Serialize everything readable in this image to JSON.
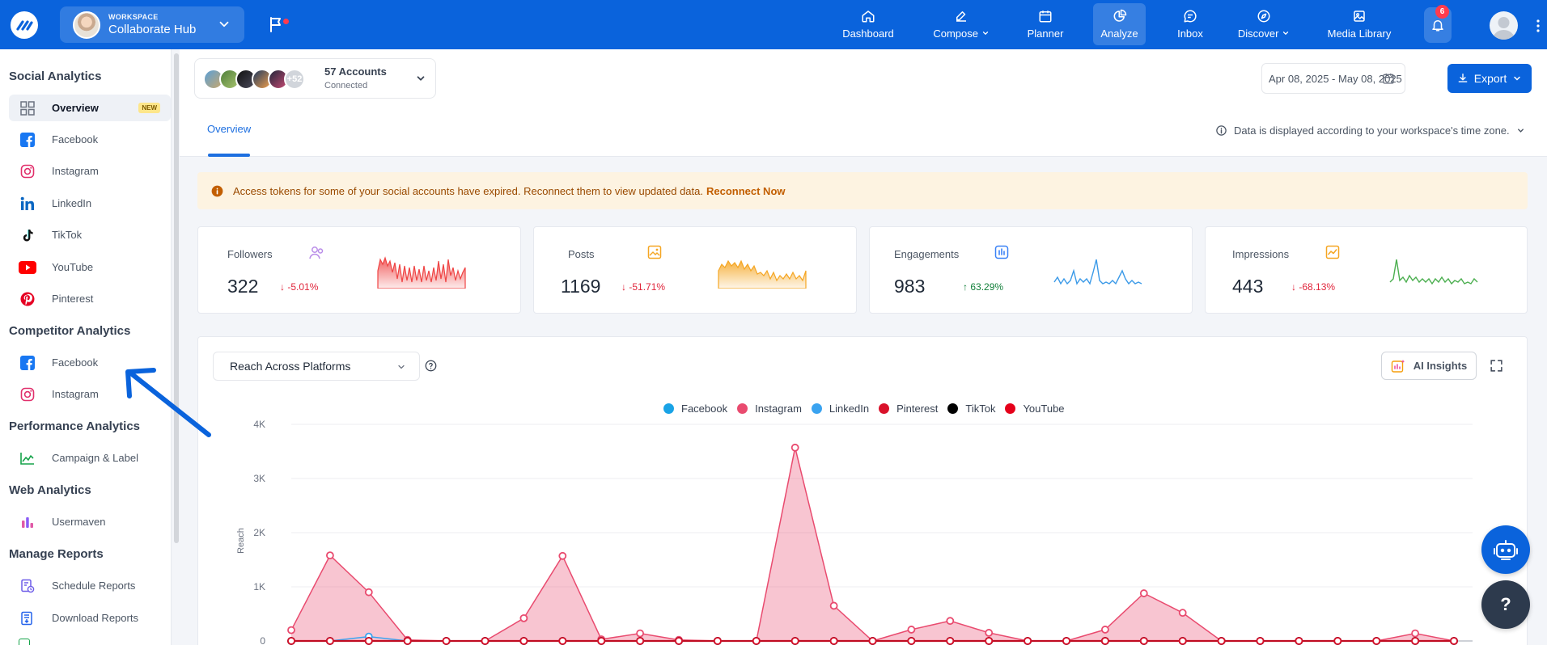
{
  "workspace": {
    "caption": "WORKSPACE",
    "name": "Collaborate Hub"
  },
  "nav": [
    {
      "label": "Dashboard",
      "icon": "home-icon"
    },
    {
      "label": "Compose",
      "icon": "pen-icon"
    },
    {
      "label": "Planner",
      "icon": "calendar-icon"
    },
    {
      "label": "Analyze",
      "icon": "chart-pie-icon"
    },
    {
      "label": "Inbox",
      "icon": "chat-icon"
    },
    {
      "label": "Discover",
      "icon": "compass-icon"
    },
    {
      "label": "Media Library",
      "icon": "image-icon"
    }
  ],
  "notifications": {
    "count": "6"
  },
  "sidebar": {
    "social_heading": "Social Analytics",
    "social_items": [
      {
        "label": "Overview",
        "badge": "NEW"
      },
      {
        "label": "Facebook"
      },
      {
        "label": "Instagram"
      },
      {
        "label": "LinkedIn"
      },
      {
        "label": "TikTok"
      },
      {
        "label": "YouTube"
      },
      {
        "label": "Pinterest"
      }
    ],
    "competitor_heading": "Competitor Analytics",
    "competitor_items": [
      {
        "label": "Facebook"
      },
      {
        "label": "Instagram"
      }
    ],
    "performance_heading": "Performance Analytics",
    "performance_items": [
      {
        "label": "Campaign & Label"
      }
    ],
    "web_heading": "Web Analytics",
    "web_items": [
      {
        "label": "Usermaven"
      }
    ],
    "reports_heading": "Manage Reports",
    "reports_items": [
      {
        "label": "Schedule Reports"
      },
      {
        "label": "Download Reports"
      }
    ]
  },
  "accounts": {
    "count_badge": "+52",
    "title": "57 Accounts",
    "subtitle": "Connected"
  },
  "date_range": "Apr 08, 2025 - May 08, 2025",
  "export_label": "Export",
  "tabs": {
    "overview": "Overview"
  },
  "timezone_note": "Data is displayed according to your workspace's time zone.",
  "alert": {
    "message": "Access tokens for some of your social accounts have expired. Reconnect them to view updated data.",
    "action": "Reconnect Now"
  },
  "kpis": [
    {
      "label": "Followers",
      "value": "322",
      "delta": "-5.01%",
      "direction": "down",
      "color": "#ef4444"
    },
    {
      "label": "Posts",
      "value": "1169",
      "delta": "-51.71%",
      "direction": "down",
      "color": "#f5a623"
    },
    {
      "label": "Engagements",
      "value": "983",
      "delta": "63.29%",
      "direction": "up",
      "color": "#3b9ae8"
    },
    {
      "label": "Impressions",
      "value": "443",
      "delta": "-68.13%",
      "direction": "down",
      "color": "#4caf50"
    }
  ],
  "chart_panel": {
    "selector": "Reach Across Platforms",
    "ai_insights": "AI Insights"
  },
  "chart_data": {
    "type": "area",
    "ylabel": "Reach",
    "ylim": [
      0,
      4000
    ],
    "yticks": [
      "0",
      "1K",
      "2K",
      "3K",
      "4K"
    ],
    "series": [
      {
        "name": "Facebook",
        "color": "#19a3e6",
        "values": [
          0,
          0,
          0,
          0,
          0,
          0,
          0,
          0,
          0,
          0,
          0,
          0,
          0,
          0,
          0,
          0,
          0,
          0,
          0,
          0,
          0,
          0,
          0,
          0,
          0,
          0,
          0,
          0,
          0,
          0,
          0
        ]
      },
      {
        "name": "Instagram",
        "color": "#e94b6f",
        "values": [
          200,
          1580,
          900,
          20,
          0,
          0,
          420,
          1570,
          30,
          140,
          20,
          0,
          0,
          3570,
          650,
          0,
          210,
          370,
          150,
          0,
          0,
          210,
          880,
          520,
          0,
          0,
          0,
          0,
          0,
          140,
          0,
          0
        ]
      },
      {
        "name": "LinkedIn",
        "color": "#3aa3f0",
        "values": [
          0,
          0,
          80,
          0,
          0,
          0,
          0,
          0,
          0,
          0,
          0,
          0,
          0,
          0,
          0,
          0,
          0,
          0,
          0,
          0,
          0,
          0,
          0,
          0,
          0,
          0,
          0,
          0,
          0,
          0,
          0
        ]
      },
      {
        "name": "Pinterest",
        "color": "#d9112a",
        "values": [
          0,
          0,
          0,
          0,
          0,
          0,
          0,
          0,
          0,
          0,
          0,
          0,
          0,
          0,
          0,
          0,
          0,
          0,
          0,
          0,
          0,
          0,
          0,
          0,
          0,
          0,
          0,
          0,
          0,
          0,
          0
        ]
      },
      {
        "name": "TikTok",
        "color": "#000000",
        "values": [
          0,
          0,
          0,
          0,
          0,
          0,
          0,
          0,
          0,
          0,
          0,
          0,
          0,
          0,
          0,
          0,
          0,
          0,
          0,
          0,
          0,
          0,
          0,
          0,
          0,
          0,
          0,
          0,
          0,
          0,
          0
        ]
      },
      {
        "name": "YouTube",
        "color": "#e5001a",
        "values": [
          0,
          0,
          0,
          0,
          0,
          0,
          0,
          0,
          0,
          0,
          0,
          0,
          0,
          0,
          0,
          0,
          0,
          0,
          0,
          0,
          0,
          0,
          0,
          0,
          0,
          0,
          0,
          0,
          0,
          0,
          0
        ]
      }
    ]
  }
}
